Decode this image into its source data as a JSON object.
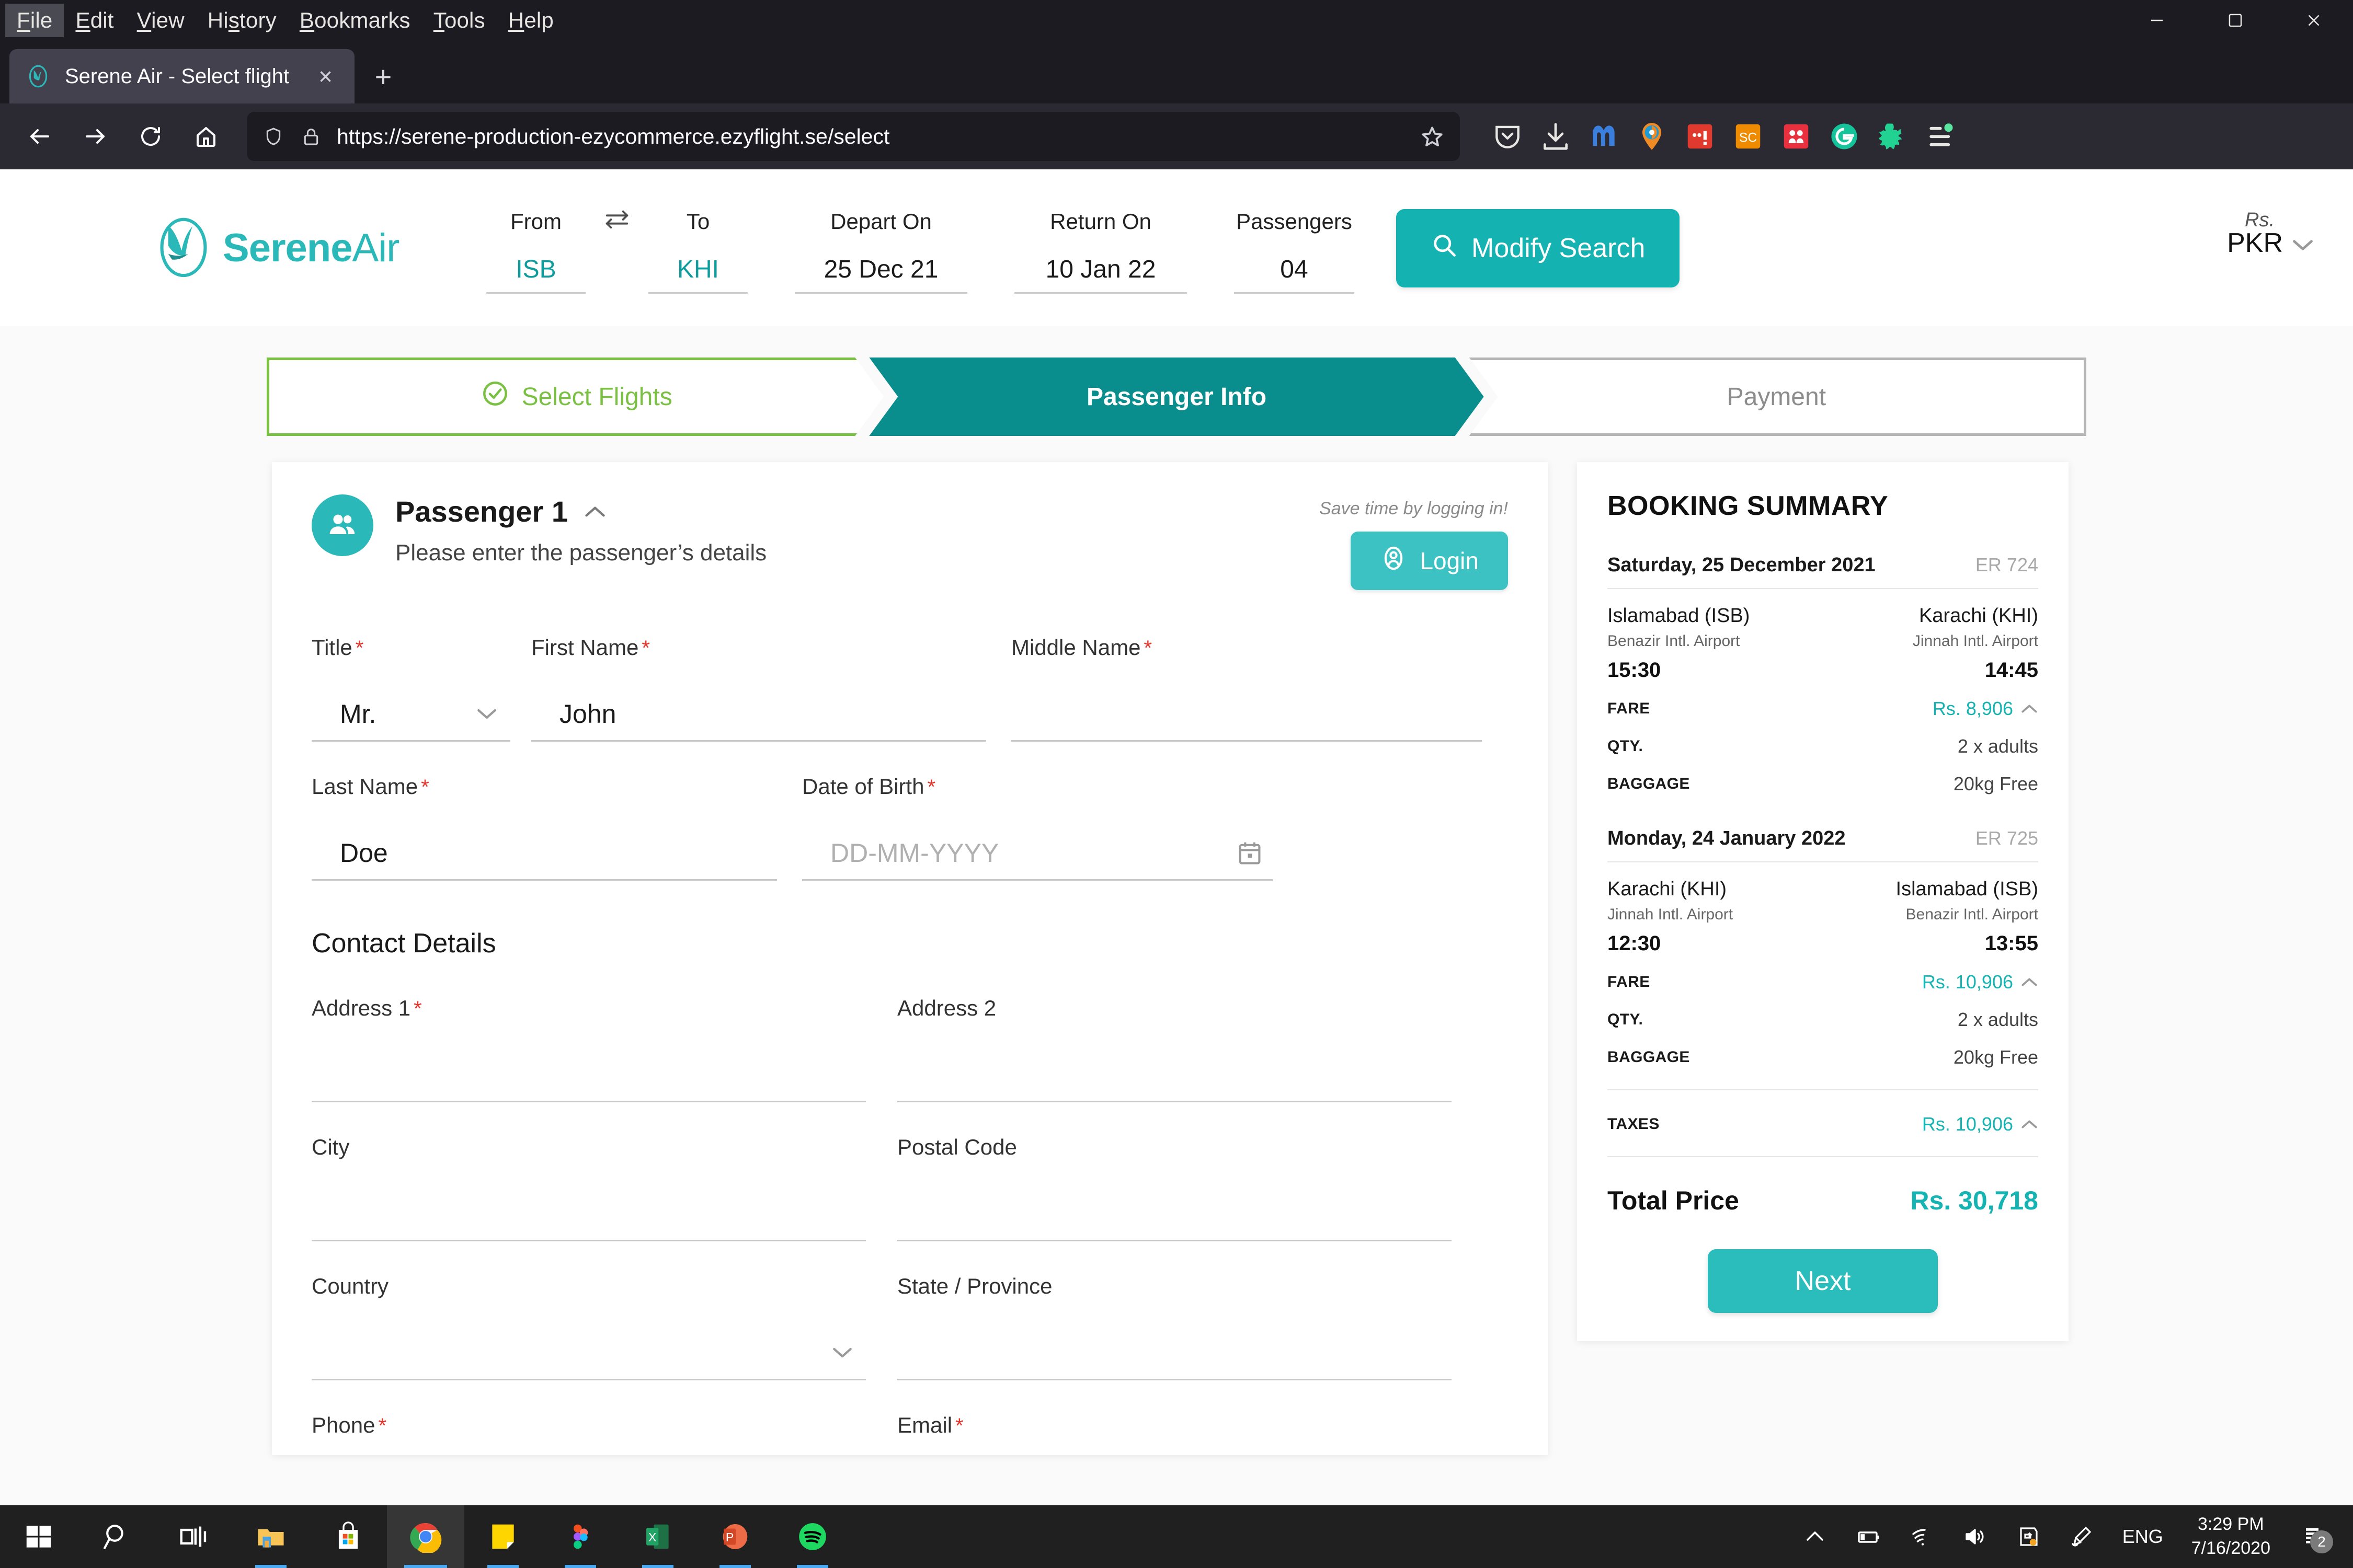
{
  "browser": {
    "menus": [
      "File",
      "Edit",
      "View",
      "History",
      "Bookmarks",
      "Tools",
      "Help"
    ],
    "window_controls": [
      "minimize-button",
      "maximize-button",
      "close-button"
    ],
    "tab": {
      "title": "Serene Air - Select flight",
      "close_label": "×"
    },
    "new_tab_label": "+",
    "url": "https://serene-production-ezycommerce.ezyflight.se/select",
    "nav": [
      "back-button",
      "forward-button",
      "reload-button",
      "home-button"
    ],
    "extensions": [
      "pocket-icon",
      "downloads-icon",
      "malwarebytes-icon",
      "hola-vpn-icon",
      "adblock-icon",
      "sc-extension-icon",
      "m-extension-icon",
      "grammarly-icon",
      "honey-icon",
      "firefox-menu-icon"
    ]
  },
  "site": {
    "brand_primary": "SereneAir",
    "brand_bold": "Serene",
    "brand_light": "Air",
    "brand_color": "#2bb8b8",
    "search": {
      "from_label": "From",
      "from_value": "ISB",
      "to_label": "To",
      "to_value": "KHI",
      "depart_label": "Depart On",
      "depart_value": "25 Dec 21",
      "return_label": "Return On",
      "return_value": "10 Jan 22",
      "passengers_label": "Passengers",
      "passengers_value": "04",
      "modify_label": "Modify Search"
    },
    "currency": {
      "symbol": "Rs.",
      "code": "PKR"
    }
  },
  "stepper": {
    "steps": [
      {
        "label": "Select Flights",
        "state": "completed",
        "color": "#7ac143"
      },
      {
        "label": "Passenger Info",
        "state": "active",
        "color": "#0a8d8d"
      },
      {
        "label": "Payment",
        "state": "pending",
        "color": "#8d8d8d"
      }
    ]
  },
  "passenger": {
    "title": "Passenger 1",
    "subtitle": "Please enter the passenger’s details",
    "login_hint": "Save time by logging in!",
    "login_label": "Login",
    "fields": {
      "title_label": "Title",
      "title_value": "Mr.",
      "first_label": "First Name",
      "first_value": "John",
      "middle_label": "Middle Name",
      "middle_value": "",
      "last_label": "Last Name",
      "last_value": "Doe",
      "dob_label": "Date of Birth",
      "dob_placeholder": "DD-MM-YYYY",
      "dob_value": ""
    },
    "contact_section": "Contact Details",
    "contact": {
      "address1_label": "Address 1",
      "address1_value": "",
      "address2_label": "Address 2",
      "address2_value": "",
      "city_label": "City",
      "city_value": "",
      "postal_label": "Postal Code",
      "postal_value": "",
      "country_label": "Country",
      "country_value": "",
      "state_label": "State / Province",
      "state_value": "",
      "phone_label": "Phone",
      "phone_value": "",
      "email_label": "Email",
      "email_value": ""
    },
    "required_mark": "*"
  },
  "summary": {
    "heading": "BOOKING SUMMARY",
    "segments": [
      {
        "date": "Saturday, 25 December 2021",
        "flight_no": "ER 724",
        "origin_city": "Islamabad (ISB)",
        "origin_airport": "Benazir Intl. Airport",
        "origin_time": "15:30",
        "dest_city": "Karachi (KHI)",
        "dest_airport": "Jinnah Intl. Airport",
        "dest_time": "14:45",
        "fare_label": "FARE",
        "fare_value": "Rs. 8,906",
        "qty_label": "QTY.",
        "qty_value": "2 x adults",
        "baggage_label": "BAGGAGE",
        "baggage_value": "20kg Free"
      },
      {
        "date": "Monday, 24 January 2022",
        "flight_no": "ER 725",
        "origin_city": "Karachi (KHI)",
        "origin_airport": "Jinnah Intl. Airport",
        "origin_time": "12:30",
        "dest_city": "Islamabad (ISB)",
        "dest_airport": "Benazir Intl. Airport",
        "dest_time": "13:55",
        "fare_label": "FARE",
        "fare_value": "Rs. 10,906",
        "qty_label": "QTY.",
        "qty_value": "2 x adults",
        "baggage_label": "BAGGAGE",
        "baggage_value": "20kg Free"
      }
    ],
    "taxes_label": "TAXES",
    "taxes_value": "Rs. 10,906",
    "total_label": "Total Price",
    "total_value": "Rs. 30,718",
    "next_label": "Next",
    "accent_color": "#16b3b3"
  },
  "taskbar": {
    "items": [
      "start-icon",
      "search-icon",
      "task-view-icon",
      "file-explorer-icon",
      "microsoft-store-icon",
      "chrome-icon",
      "sticky-notes-icon",
      "figma-icon",
      "excel-icon",
      "powerpoint-icon",
      "spotify-icon"
    ],
    "tray": [
      "show-hidden-icons",
      "battery-icon",
      "wifi-icon",
      "volume-icon",
      "onedrive-icon",
      "pen-icon"
    ],
    "language": "ENG",
    "time": "3:29 PM",
    "date": "7/16/2020",
    "notification_count": "2"
  }
}
